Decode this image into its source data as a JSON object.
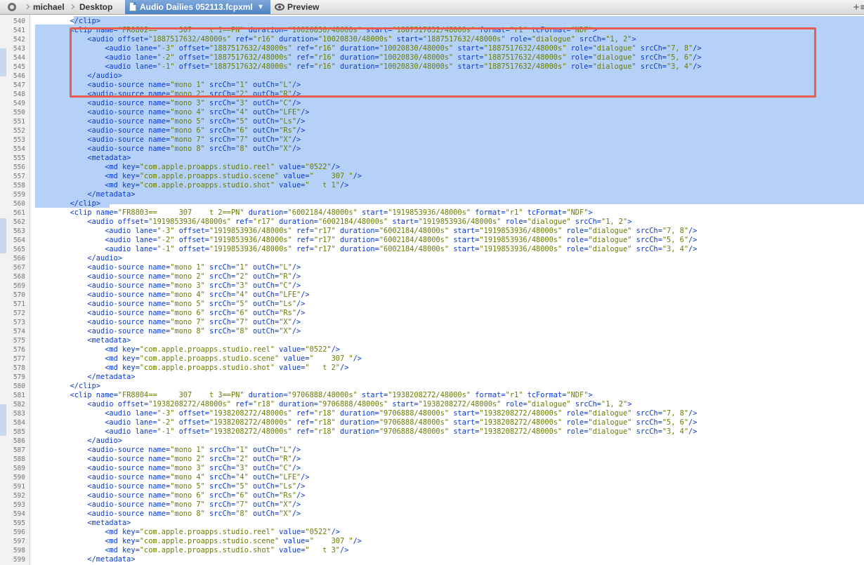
{
  "pathbar": {
    "crumbs": [
      "michael",
      "Desktop"
    ],
    "active_file": "Audio Dailies 052113.fcpxml",
    "preview_label": "Preview",
    "right_control": "+≡"
  },
  "editor": {
    "lines": [
      {
        "n": "540",
        "t": "        </clip>"
      },
      {
        "n": "541",
        "t": "        <clip name=\"FR8802==     307    t 1==PN\" duration=\"10020830/48000s\" start=\"1887517632/48000s\" format=\"r1\" tcFormat=\"NDF\">"
      },
      {
        "n": "542",
        "t": "            <audio offset=\"1887517632/48000s\" ref=\"r16\" duration=\"10020830/48000s\" start=\"1887517632/48000s\" role=\"dialogue\" srcCh=\"1, 2\">"
      },
      {
        "n": "543",
        "t": "                <audio lane=\"-3\" offset=\"1887517632/48000s\" ref=\"r16\" duration=\"10020830/48000s\" start=\"1887517632/48000s\" role=\"dialogue\" srcCh=\"7, 8\"/>"
      },
      {
        "n": "544",
        "t": "                <audio lane=\"-2\" offset=\"1887517632/48000s\" ref=\"r16\" duration=\"10020830/48000s\" start=\"1887517632/48000s\" role=\"dialogue\" srcCh=\"5, 6\"/>"
      },
      {
        "n": "545",
        "t": "                <audio lane=\"-1\" offset=\"1887517632/48000s\" ref=\"r16\" duration=\"10020830/48000s\" start=\"1887517632/48000s\" role=\"dialogue\" srcCh=\"3, 4\"/>"
      },
      {
        "n": "546",
        "t": "            </audio>"
      },
      {
        "n": "547",
        "t": "            <audio-source name=\"mono 1\" srcCh=\"1\" outCh=\"L\"/>"
      },
      {
        "n": "548",
        "t": "            <audio-source name=\"mono 2\" srcCh=\"2\" outCh=\"R\"/>"
      },
      {
        "n": "549",
        "t": "            <audio-source name=\"mono 3\" srcCh=\"3\" outCh=\"C\"/>"
      },
      {
        "n": "550",
        "t": "            <audio-source name=\"mono 4\" srcCh=\"4\" outCh=\"LFE\"/>"
      },
      {
        "n": "551",
        "t": "            <audio-source name=\"mono 5\" srcCh=\"5\" outCh=\"Ls\"/>"
      },
      {
        "n": "552",
        "t": "            <audio-source name=\"mono 6\" srcCh=\"6\" outCh=\"Rs\"/>"
      },
      {
        "n": "553",
        "t": "            <audio-source name=\"mono 7\" srcCh=\"7\" outCh=\"X\"/>"
      },
      {
        "n": "554",
        "t": "            <audio-source name=\"mono 8\" srcCh=\"8\" outCh=\"X\"/>"
      },
      {
        "n": "555",
        "t": "            <metadata>"
      },
      {
        "n": "556",
        "t": "                <md key=\"com.apple.proapps.studio.reel\" value=\"0522\"/>"
      },
      {
        "n": "557",
        "t": "                <md key=\"com.apple.proapps.studio.scene\" value=\"    307 \"/>"
      },
      {
        "n": "558",
        "t": "                <md key=\"com.apple.proapps.studio.shot\" value=\"   t 1\"/>"
      },
      {
        "n": "559",
        "t": "            </metadata>"
      },
      {
        "n": "560",
        "t": "        </clip>"
      },
      {
        "n": "561",
        "t": "        <clip name=\"FR8803==     307    t 2==PN\" duration=\"6002184/48000s\" start=\"1919853936/48000s\" format=\"r1\" tcFormat=\"NDF\">"
      },
      {
        "n": "562",
        "t": "            <audio offset=\"1919853936/48000s\" ref=\"r17\" duration=\"6002184/48000s\" start=\"1919853936/48000s\" role=\"dialogue\" srcCh=\"1, 2\">"
      },
      {
        "n": "563",
        "t": "                <audio lane=\"-3\" offset=\"1919853936/48000s\" ref=\"r17\" duration=\"6002184/48000s\" start=\"1919853936/48000s\" role=\"dialogue\" srcCh=\"7, 8\"/>"
      },
      {
        "n": "564",
        "t": "                <audio lane=\"-2\" offset=\"1919853936/48000s\" ref=\"r17\" duration=\"6002184/48000s\" start=\"1919853936/48000s\" role=\"dialogue\" srcCh=\"5, 6\"/>"
      },
      {
        "n": "565",
        "t": "                <audio lane=\"-1\" offset=\"1919853936/48000s\" ref=\"r17\" duration=\"6002184/48000s\" start=\"1919853936/48000s\" role=\"dialogue\" srcCh=\"3, 4\"/>"
      },
      {
        "n": "566",
        "t": "            </audio>"
      },
      {
        "n": "567",
        "t": "            <audio-source name=\"mono 1\" srcCh=\"1\" outCh=\"L\"/>"
      },
      {
        "n": "568",
        "t": "            <audio-source name=\"mono 2\" srcCh=\"2\" outCh=\"R\"/>"
      },
      {
        "n": "569",
        "t": "            <audio-source name=\"mono 3\" srcCh=\"3\" outCh=\"C\"/>"
      },
      {
        "n": "570",
        "t": "            <audio-source name=\"mono 4\" srcCh=\"4\" outCh=\"LFE\"/>"
      },
      {
        "n": "571",
        "t": "            <audio-source name=\"mono 5\" srcCh=\"5\" outCh=\"Ls\"/>"
      },
      {
        "n": "572",
        "t": "            <audio-source name=\"mono 6\" srcCh=\"6\" outCh=\"Rs\"/>"
      },
      {
        "n": "573",
        "t": "            <audio-source name=\"mono 7\" srcCh=\"7\" outCh=\"X\"/>"
      },
      {
        "n": "574",
        "t": "            <audio-source name=\"mono 8\" srcCh=\"8\" outCh=\"X\"/>"
      },
      {
        "n": "575",
        "t": "            <metadata>"
      },
      {
        "n": "576",
        "t": "                <md key=\"com.apple.proapps.studio.reel\" value=\"0522\"/>"
      },
      {
        "n": "577",
        "t": "                <md key=\"com.apple.proapps.studio.scene\" value=\"    307 \"/>"
      },
      {
        "n": "578",
        "t": "                <md key=\"com.apple.proapps.studio.shot\" value=\"   t 2\"/>"
      },
      {
        "n": "579",
        "t": "            </metadata>"
      },
      {
        "n": "580",
        "t": "        </clip>"
      },
      {
        "n": "581",
        "t": "        <clip name=\"FR8804==     307    t 3==PN\" duration=\"9706888/48000s\" start=\"1938208272/48000s\" format=\"r1\" tcFormat=\"NDF\">"
      },
      {
        "n": "582",
        "t": "            <audio offset=\"1938208272/48000s\" ref=\"r18\" duration=\"9706888/48000s\" start=\"1938208272/48000s\" role=\"dialogue\" srcCh=\"1, 2\">"
      },
      {
        "n": "583",
        "t": "                <audio lane=\"-3\" offset=\"1938208272/48000s\" ref=\"r18\" duration=\"9706888/48000s\" start=\"1938208272/48000s\" role=\"dialogue\" srcCh=\"7, 8\"/>"
      },
      {
        "n": "584",
        "t": "                <audio lane=\"-2\" offset=\"1938208272/48000s\" ref=\"r18\" duration=\"9706888/48000s\" start=\"1938208272/48000s\" role=\"dialogue\" srcCh=\"5, 6\"/>"
      },
      {
        "n": "585",
        "t": "                <audio lane=\"-1\" offset=\"1938208272/48000s\" ref=\"r18\" duration=\"9706888/48000s\" start=\"1938208272/48000s\" role=\"dialogue\" srcCh=\"3, 4\"/>"
      },
      {
        "n": "586",
        "t": "            </audio>"
      },
      {
        "n": "587",
        "t": "            <audio-source name=\"mono 1\" srcCh=\"1\" outCh=\"L\"/>"
      },
      {
        "n": "588",
        "t": "            <audio-source name=\"mono 2\" srcCh=\"2\" outCh=\"R\"/>"
      },
      {
        "n": "589",
        "t": "            <audio-source name=\"mono 3\" srcCh=\"3\" outCh=\"C\"/>"
      },
      {
        "n": "590",
        "t": "            <audio-source name=\"mono 4\" srcCh=\"4\" outCh=\"LFE\"/>"
      },
      {
        "n": "591",
        "t": "            <audio-source name=\"mono 5\" srcCh=\"5\" outCh=\"Ls\"/>"
      },
      {
        "n": "592",
        "t": "            <audio-source name=\"mono 6\" srcCh=\"6\" outCh=\"Rs\"/>"
      },
      {
        "n": "593",
        "t": "            <audio-source name=\"mono 7\" srcCh=\"7\" outCh=\"X\"/>"
      },
      {
        "n": "594",
        "t": "            <audio-source name=\"mono 8\" srcCh=\"8\" outCh=\"X\"/>"
      },
      {
        "n": "595",
        "t": "            <metadata>"
      },
      {
        "n": "596",
        "t": "                <md key=\"com.apple.proapps.studio.reel\" value=\"0522\"/>"
      },
      {
        "n": "597",
        "t": "                <md key=\"com.apple.proapps.studio.scene\" value=\"    307 \"/>"
      },
      {
        "n": "598",
        "t": "                <md key=\"com.apple.proapps.studio.shot\" value=\"   t 3\"/>"
      },
      {
        "n": "599",
        "t": "            </metadata>"
      }
    ]
  },
  "colors": {
    "selection": "#b6d1f7",
    "highlight_box": "#e85c4e",
    "tag": "#0a3bd6",
    "attr_value": "#6b7d00"
  }
}
